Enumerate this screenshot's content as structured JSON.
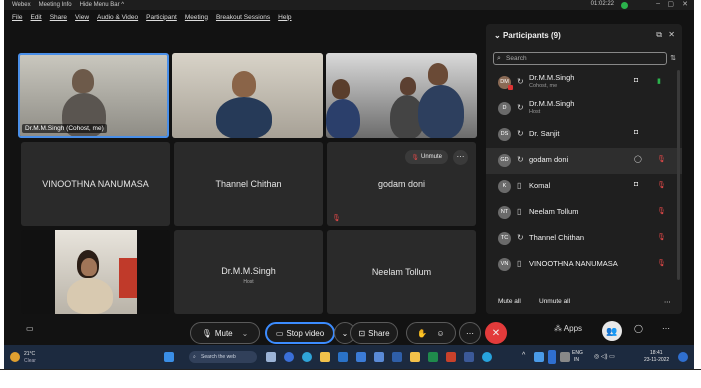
{
  "titlebar": {
    "app": "Webex",
    "meeting_info": "Meeting Info",
    "hide_menu": "Hide Menu Bar ^",
    "timer": "01:02:22",
    "minimize": "–",
    "close": "✕"
  },
  "menu": [
    "File",
    "Edit",
    "Share",
    "View",
    "Audio & Video",
    "Participant",
    "Meeting",
    "Breakout Sessions",
    "Help"
  ],
  "tiles": {
    "t1_tag": "Dr.M.M.Singh (Cohost, me)",
    "t4_name": "VINOOTHNA NANUMASA",
    "t5_name": "Thannel Chithan",
    "t6_name": "godam doni",
    "t6_unmute": "Unmute",
    "t8_name": "Dr.M.M.Singh",
    "t8_sub": "Host",
    "t9_name": "Neelam Tollum"
  },
  "panel": {
    "title": "Participants (9)",
    "search_placeholder": "Search",
    "participants": [
      {
        "initials": "DM",
        "name": "Dr.M.M.Singh",
        "sub": "Cohost, me",
        "mic": "green"
      },
      {
        "initials": "D",
        "name": "Dr.M.M.Singh",
        "sub": "Host",
        "mic": "none"
      },
      {
        "initials": "DS",
        "name": "Dr. Sanjit",
        "sub": "",
        "mic": "none"
      },
      {
        "initials": "GD",
        "name": "godam doni",
        "sub": "",
        "mic": "muted"
      },
      {
        "initials": "K",
        "name": "Komal",
        "sub": "",
        "mic": "muted"
      },
      {
        "initials": "NT",
        "name": "Neelam Tollum",
        "sub": "",
        "mic": "muted"
      },
      {
        "initials": "TC",
        "name": "Thannel Chithan",
        "sub": "",
        "mic": "muted"
      },
      {
        "initials": "VN",
        "name": "VINOOTHNA NANUMASA",
        "sub": "",
        "mic": "muted"
      }
    ],
    "mute_all": "Mute all",
    "unmute_all": "Unmute all"
  },
  "controls": {
    "mute": "Mute",
    "stop_video": "Stop video",
    "share": "Share",
    "apps": "Apps"
  },
  "taskbar": {
    "temp": "21°C",
    "weather": "Clear",
    "search": "Search the web",
    "lang1": "ENG",
    "lang2": "IN",
    "time": "18:41",
    "date": "23-11-2022"
  },
  "colors": {
    "accent": "#3c8cff",
    "end_call": "#e33b3b",
    "muted": "#e04848",
    "speaking": "#2bb24c"
  }
}
